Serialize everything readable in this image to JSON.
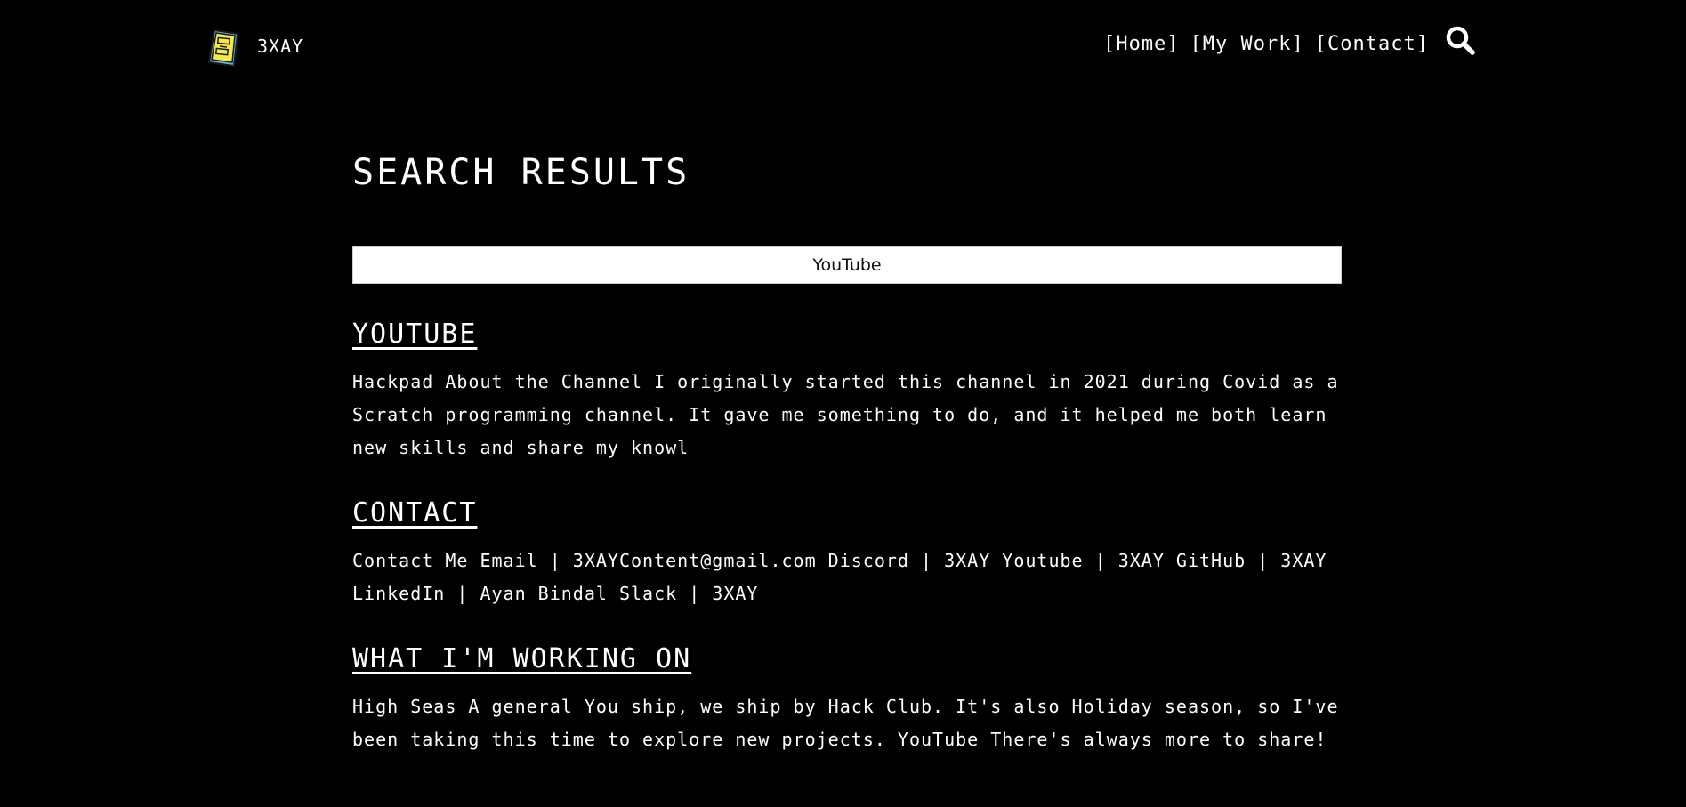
{
  "header": {
    "site_name": "3XAY",
    "logo_icon": "notebook-face-icon",
    "colors": {
      "logo_fill": "#f5e94a",
      "logo_border": "#5fb7e0"
    }
  },
  "nav": {
    "home": "[Home]",
    "work": "[My Work]",
    "contact": "[Contact]",
    "search_icon": "search-icon"
  },
  "main": {
    "title": "SEARCH RESULTS",
    "search_value": "YouTube",
    "results": [
      {
        "title": "YOUTUBE",
        "snippet": "Hackpad About the Channel I originally started this channel in 2021 during Covid as a Scratch programming channel. It gave me something to do, and it helped me both learn new skills and share my knowl"
      },
      {
        "title": "CONTACT",
        "snippet": "Contact Me Email | 3XAYContent@gmail.com Discord | 3XAY Youtube | 3XAY GitHub | 3XAY LinkedIn | Ayan Bindal Slack | 3XAY"
      },
      {
        "title": "WHAT I'M WORKING ON",
        "snippet": "High Seas A general You ship, we ship by Hack Club. It's also Holiday season, so I've been taking this time to explore new projects. YouTube There's always more to share!"
      }
    ]
  }
}
